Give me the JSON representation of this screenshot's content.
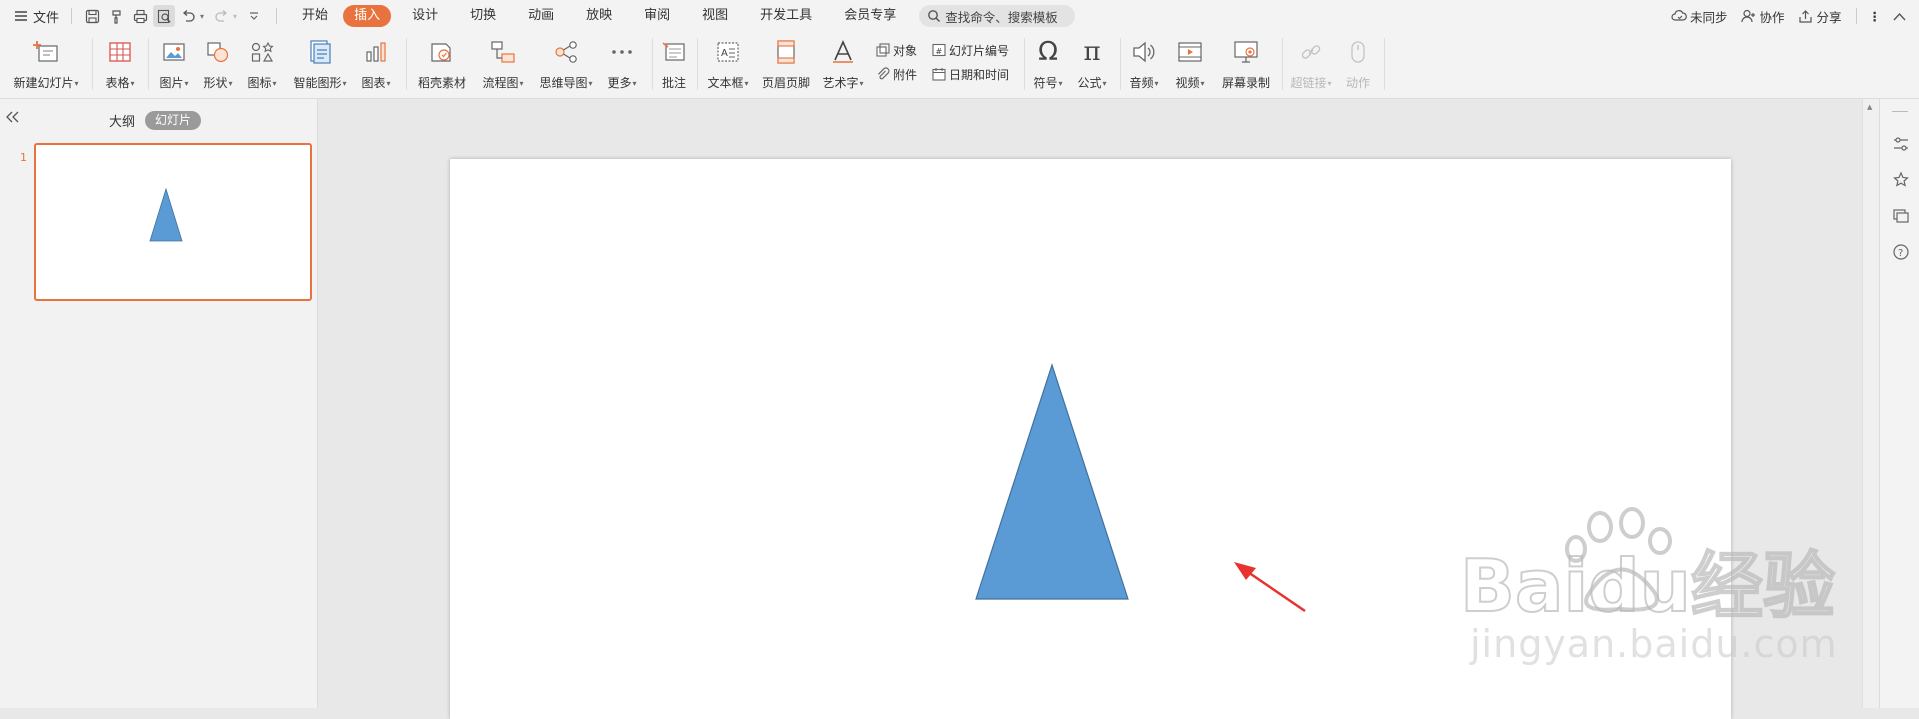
{
  "menubar": {
    "file_label": "文件",
    "tabs": [
      {
        "label": "开始",
        "active": false
      },
      {
        "label": "插入",
        "active": true
      },
      {
        "label": "设计",
        "active": false
      },
      {
        "label": "切换",
        "active": false
      },
      {
        "label": "动画",
        "active": false
      },
      {
        "label": "放映",
        "active": false
      },
      {
        "label": "审阅",
        "active": false
      },
      {
        "label": "视图",
        "active": false
      },
      {
        "label": "开发工具",
        "active": false
      },
      {
        "label": "会员专享",
        "active": false
      }
    ],
    "search_placeholder": "查找命令、搜索模板",
    "sync_label": "未同步",
    "collab_label": "协作",
    "share_label": "分享",
    "accent_color": "#e9733e"
  },
  "ribbon": {
    "new_slide": "新建幻灯片",
    "table": "表格",
    "picture": "图片",
    "shape": "形状",
    "icon": "图标",
    "smart_art": "智能图形",
    "chart": "图表",
    "daoke": "稻壳素材",
    "flowchart": "流程图",
    "mindmap": "思维导图",
    "more": "更多",
    "comment": "批注",
    "textbox": "文本框",
    "header_footer": "页眉页脚",
    "wordart": "艺术字",
    "object": "对象",
    "attachment": "附件",
    "slide_number": "幻灯片编号",
    "date_time": "日期和时间",
    "symbol": "符号",
    "formula": "公式",
    "audio": "音频",
    "video": "视频",
    "screen_record": "屏幕录制",
    "hyperlink": "超链接",
    "action": "动作"
  },
  "left_pane": {
    "outline_tab": "大纲",
    "slides_tab": "幻灯片",
    "slide_number": "1"
  },
  "slide": {
    "shape": "isosceles-triangle",
    "shape_fill": "#5b9bd5",
    "shape_stroke": "#41719c",
    "arrow_color": "#e8322e"
  },
  "watermark": {
    "brand": "Baidu经验",
    "domain": "jingyan.baidu.com"
  }
}
